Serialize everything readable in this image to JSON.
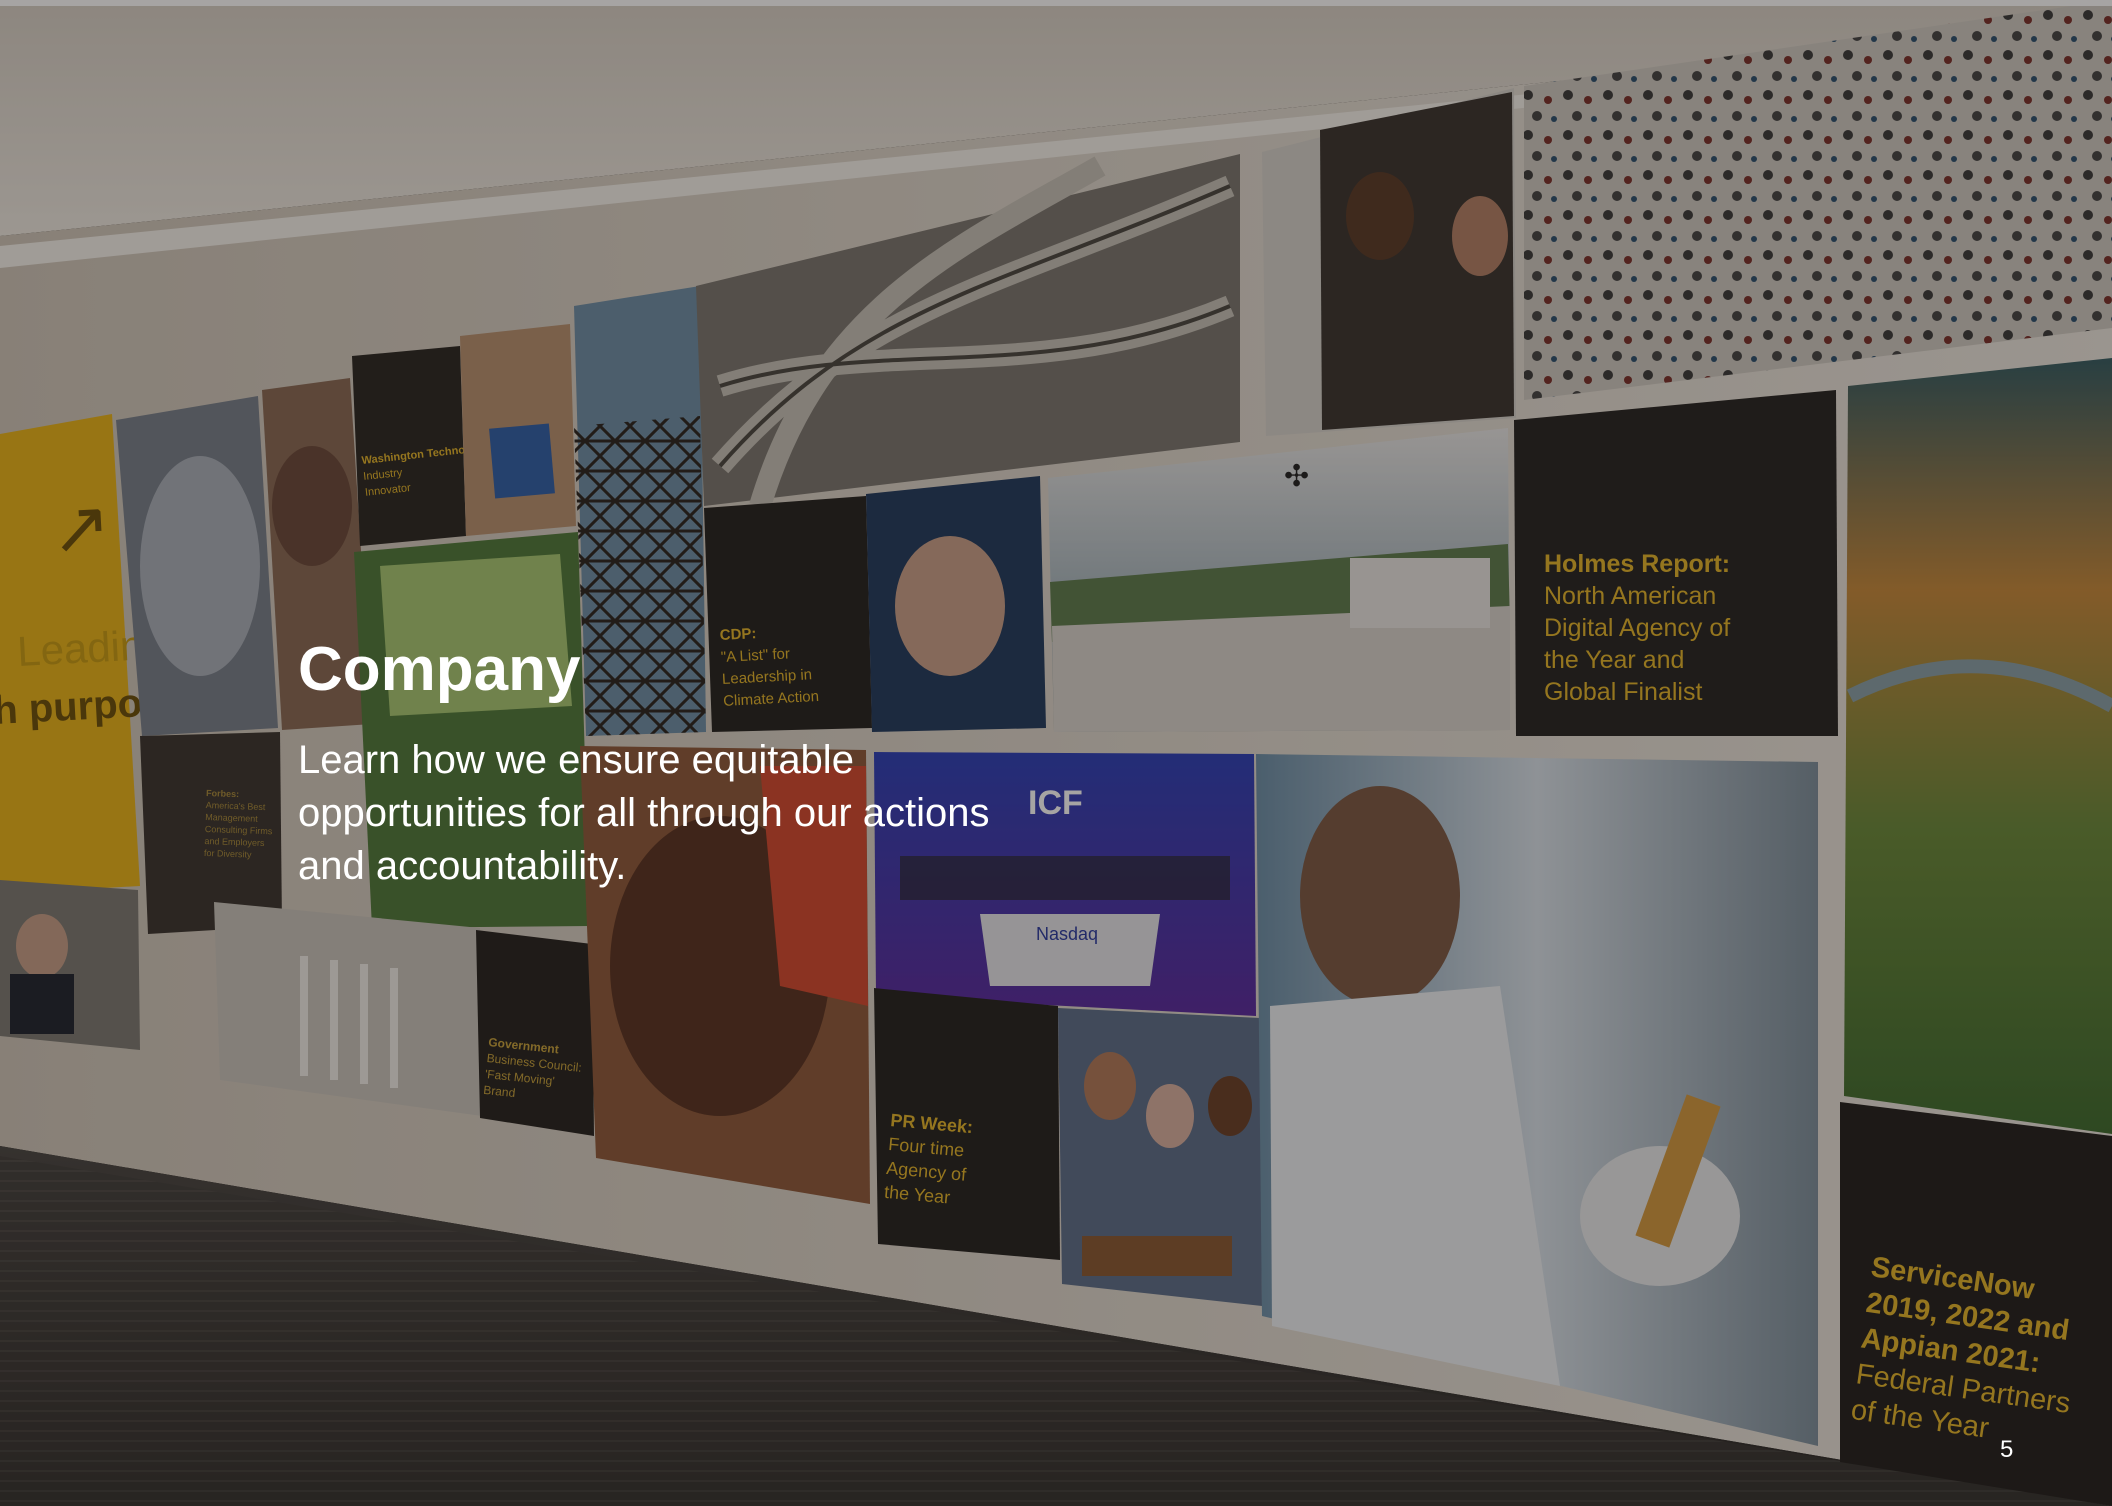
{
  "page": {
    "title": "Company",
    "subtitle": "Learn how we ensure equitable opportunities for all through our actions and accountability.",
    "page_number": "5"
  },
  "wall": {
    "yellow_panel": {
      "arrow": "↗",
      "line1": "Leading",
      "line2": "h purpose"
    },
    "awards": [
      {
        "title": "Washington Technology:",
        "lines": [
          "Industry",
          "Innovator"
        ]
      },
      {
        "title": "CDP:",
        "lines": [
          "\"A List\" for",
          "Leadership in",
          "Climate Action"
        ]
      },
      {
        "title": "Holmes Report:",
        "lines": [
          "North American",
          "Digital Agency of",
          "the Year and",
          "Global Finalist"
        ]
      },
      {
        "title": "Forbes:",
        "lines": [
          "America's Best",
          "Management",
          "Consulting Firms",
          "and Employers",
          "for Diversity"
        ]
      },
      {
        "title": "Government",
        "lines": [
          "Business Council:",
          "'Fast Moving'",
          "Brand"
        ]
      },
      {
        "title": "PR Week:",
        "lines": [
          "Four time",
          "Agency of",
          "the Year"
        ]
      },
      {
        "title": "ServiceNow",
        "lines": [
          "2019, 2022 and",
          "Appian 2021:",
          "Federal Partners",
          "of the Year"
        ]
      }
    ],
    "stage_logo": "ICF",
    "stage_sign": "Nasdaq"
  },
  "colors": {
    "accent_yellow": "#e9b419",
    "award_text": "#e4b52a",
    "panel_dark": "#222"
  }
}
